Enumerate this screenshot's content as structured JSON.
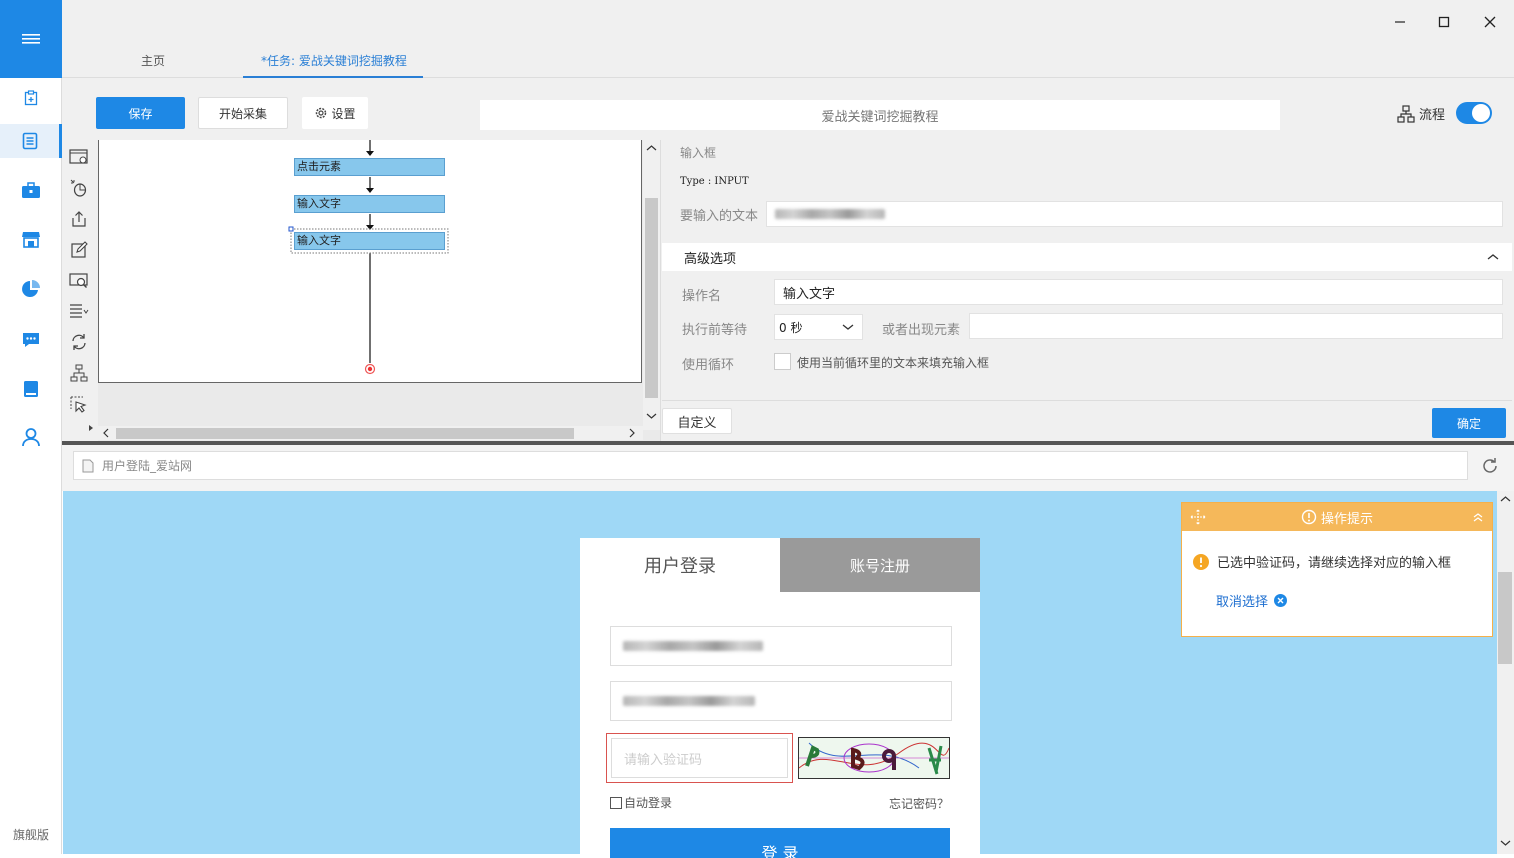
{
  "edition": "旗舰版",
  "tabs": {
    "home": "主页",
    "task": "*任务: 爱战关键词挖掘教程"
  },
  "toolbar": {
    "save": "保存",
    "start": "开始采集",
    "settings": "设置",
    "task_name": "爱战关键词挖掘教程",
    "flow": "流程"
  },
  "flow": {
    "nodes": [
      "点击元素",
      "输入文字",
      "输入文字"
    ]
  },
  "props": {
    "section_title": "输入框",
    "type_line": "Type : INPUT",
    "text_label": "要输入的文本",
    "advanced": "高级选项",
    "op_name_label": "操作名",
    "op_name_value": "输入文字",
    "wait_label": "执行前等待",
    "wait_value": "0 秒",
    "or_element_label": "或者出现元素",
    "loop_label": "使用循环",
    "loop_checkbox": "使用当前循环里的文本来填充输入框",
    "custom": "自定义",
    "ok": "确定"
  },
  "browser": {
    "url_title": "用户登陆_爱站网"
  },
  "login": {
    "tab_login": "用户登录",
    "tab_register": "账号注册",
    "captcha_placeholder": "请输入验证码",
    "auto_login": "自动登录",
    "forgot": "忘记密码？",
    "submit": "登 录"
  },
  "tip": {
    "title": "操作提示",
    "message": "已选中验证码，请继续选择对应的输入框",
    "cancel": "取消选择"
  },
  "colors": {
    "accent": "#1e88e5",
    "tip": "#f5b85a",
    "web_bg": "#9fd8f6"
  }
}
